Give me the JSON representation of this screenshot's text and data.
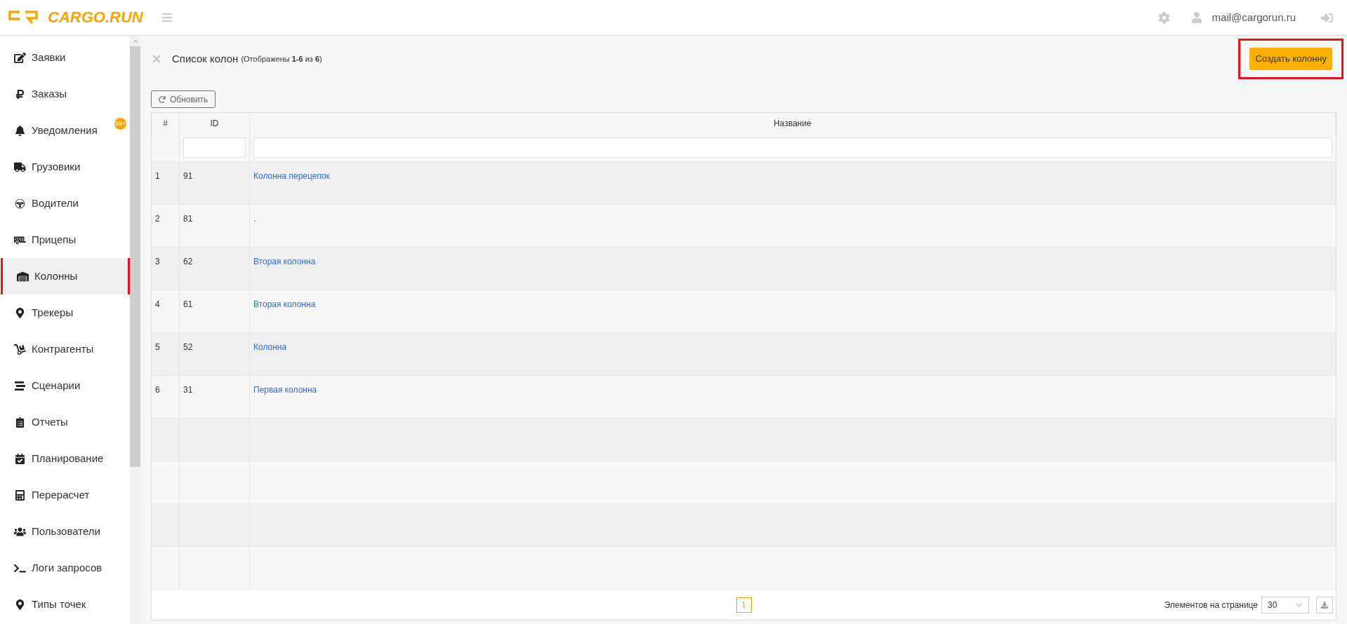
{
  "header": {
    "logo": "CARGO.RUN",
    "user_email": "mail@cargorun.ru"
  },
  "sidebar": {
    "items": [
      {
        "label": "Заявки",
        "selected": false
      },
      {
        "label": "Заказы",
        "selected": false
      },
      {
        "label": "Уведомления",
        "selected": false,
        "badge": "99+"
      },
      {
        "label": "Грузовики",
        "selected": false
      },
      {
        "label": "Водители",
        "selected": false
      },
      {
        "label": "Прицепы",
        "selected": false
      },
      {
        "label": "Колонны",
        "selected": true
      },
      {
        "label": "Трекеры",
        "selected": false
      },
      {
        "label": "Контрагенты",
        "selected": false
      },
      {
        "label": "Сценарии",
        "selected": false
      },
      {
        "label": "Отчеты",
        "selected": false
      },
      {
        "label": "Планирование",
        "selected": false
      },
      {
        "label": "Перерасчет",
        "selected": false
      },
      {
        "label": "Пользователи",
        "selected": false
      },
      {
        "label": "Логи запросов",
        "selected": false
      },
      {
        "label": "Типы точек",
        "selected": false
      }
    ]
  },
  "page": {
    "title": "Список колон",
    "subtitle": "(Отображены **1-6** из **6**)",
    "create_button": "Создать колонну",
    "refresh_button": "Обновить"
  },
  "table": {
    "columns": [
      "#",
      "ID",
      "Название"
    ],
    "rows": [
      {
        "num": "1",
        "id": "91",
        "name": "Колонна перецепок"
      },
      {
        "num": "2",
        "id": "81",
        "name": "."
      },
      {
        "num": "3",
        "id": "62",
        "name": "Вторая колонна"
      },
      {
        "num": "4",
        "id": "61",
        "name": "Вторая колонна"
      },
      {
        "num": "5",
        "id": "52",
        "name": "Колонна"
      },
      {
        "num": "6",
        "id": "31",
        "name": "Первая колонна"
      }
    ]
  },
  "footer": {
    "pages": [
      {
        "label": "1",
        "selected": true
      }
    ],
    "page_size_label": "Элементов на странице",
    "page_size": "30"
  }
}
